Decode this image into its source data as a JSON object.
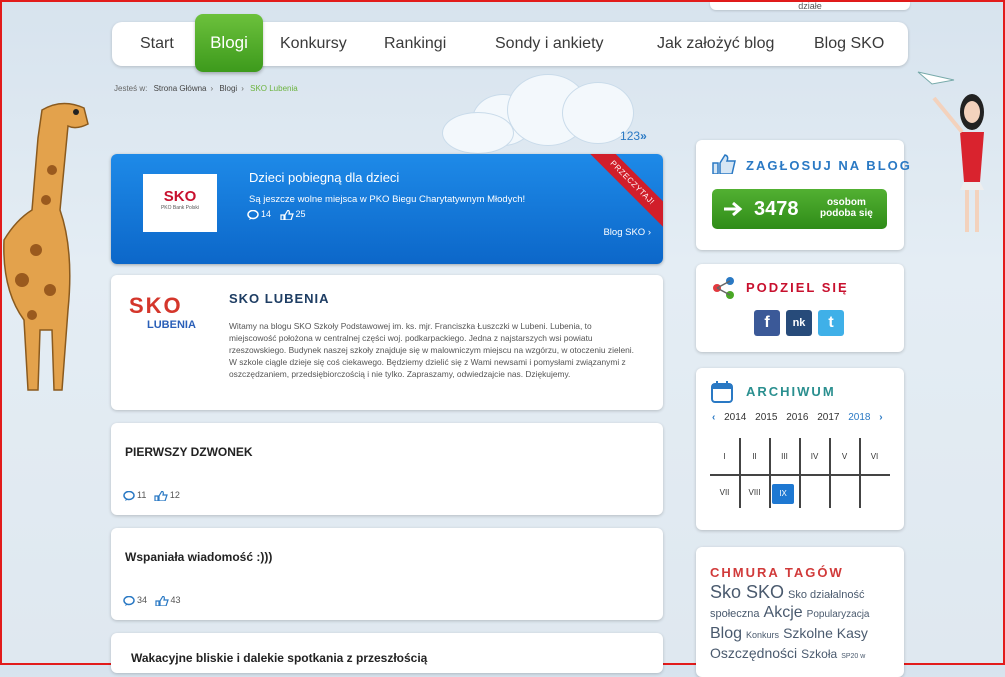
{
  "top_snippet": "działe",
  "nav": {
    "items": [
      "Start",
      "Blogi",
      "Konkursy",
      "Rankingi",
      "Sondy i ankiety",
      "Jak założyć blog",
      "Blog SKO"
    ],
    "active": "Blogi"
  },
  "breadcrumb": {
    "prefix": "Jesteś w:",
    "items": [
      "Strona Główna",
      "Blogi",
      "SKO Lubenia"
    ]
  },
  "pagination": {
    "pages": [
      "1",
      "2",
      "3"
    ],
    "next": "»"
  },
  "featured": {
    "logo_text": "SKO",
    "logo_sub": "PKO Bank Polski",
    "title": "Dzieci pobiegną dla dzieci",
    "description": "Są jeszcze wolne miejsca w PKO Biegu Charytatywnym Młodych!",
    "comments": "14",
    "likes": "25",
    "link": "Blog SKO ›",
    "ribbon": "Przeczytaj!"
  },
  "blog": {
    "logo_text": "SKO",
    "logo_sub": "LUBENIA",
    "title": "SKO LUBENIA",
    "description": "Witamy na blogu SKO Szkoły Podstawowej im. ks. mjr. Franciszka Łuszczki w Lubeni. Lubenia, to miejscowość położona w centralnej części woj. podkarpackiego. Jedna z najstarszych wsi powiatu rzeszowskiego. Budynek naszej szkoły znajduje się w malowniczym miejscu na wzgórzu, w otoczeniu zieleni. W szkole ciągle dzieje się coś ciekawego. Będziemy dzielić się z Wami newsami i pomysłami związanymi z oszczędzaniem, przedsiębiorczością i nie tylko. Zapraszamy, odwiedzajcie nas. Dziękujemy."
  },
  "posts": [
    {
      "title": "PIERWSZY DZWONEK",
      "comments": "11",
      "likes": "12"
    },
    {
      "title": "Wspaniała wiadomość :)))",
      "comments": "34",
      "likes": "43"
    },
    {
      "title": "Wakacyjne bliskie i dalekie spotkania z przeszłością"
    }
  ],
  "vote": {
    "title": "ZAGŁOSUJ NA BLOG",
    "count": "3478",
    "label_line1": "osobom",
    "label_line2": "podoba się"
  },
  "share": {
    "title": "PODZIEL SIĘ",
    "buttons": [
      "f",
      "nk",
      "t"
    ]
  },
  "archive": {
    "title": "ARCHIWUM",
    "years": [
      "2014",
      "2015",
      "2016",
      "2017",
      "2018"
    ],
    "active_year": "2018",
    "months": [
      "I",
      "II",
      "III",
      "IV",
      "V",
      "VI",
      "VII",
      "VIII",
      "IX"
    ],
    "active_month": "IX"
  },
  "tags": {
    "title": "CHMURA TAGÓW",
    "items": [
      "Sko SKO",
      "Sko działalność",
      "społeczna",
      "Akcje",
      "Popularyzacja",
      "Blog",
      "Konkurs",
      "Szkolne Kasy",
      "Oszczędności",
      "Szkoła",
      "SP20 w"
    ]
  },
  "colors": {
    "nav_active": "#4aa825",
    "featured_bg": "#1478d6",
    "ribbon": "#d11e2a",
    "vote_btn": "#3f9d22",
    "link_blue": "#2a79c4"
  }
}
